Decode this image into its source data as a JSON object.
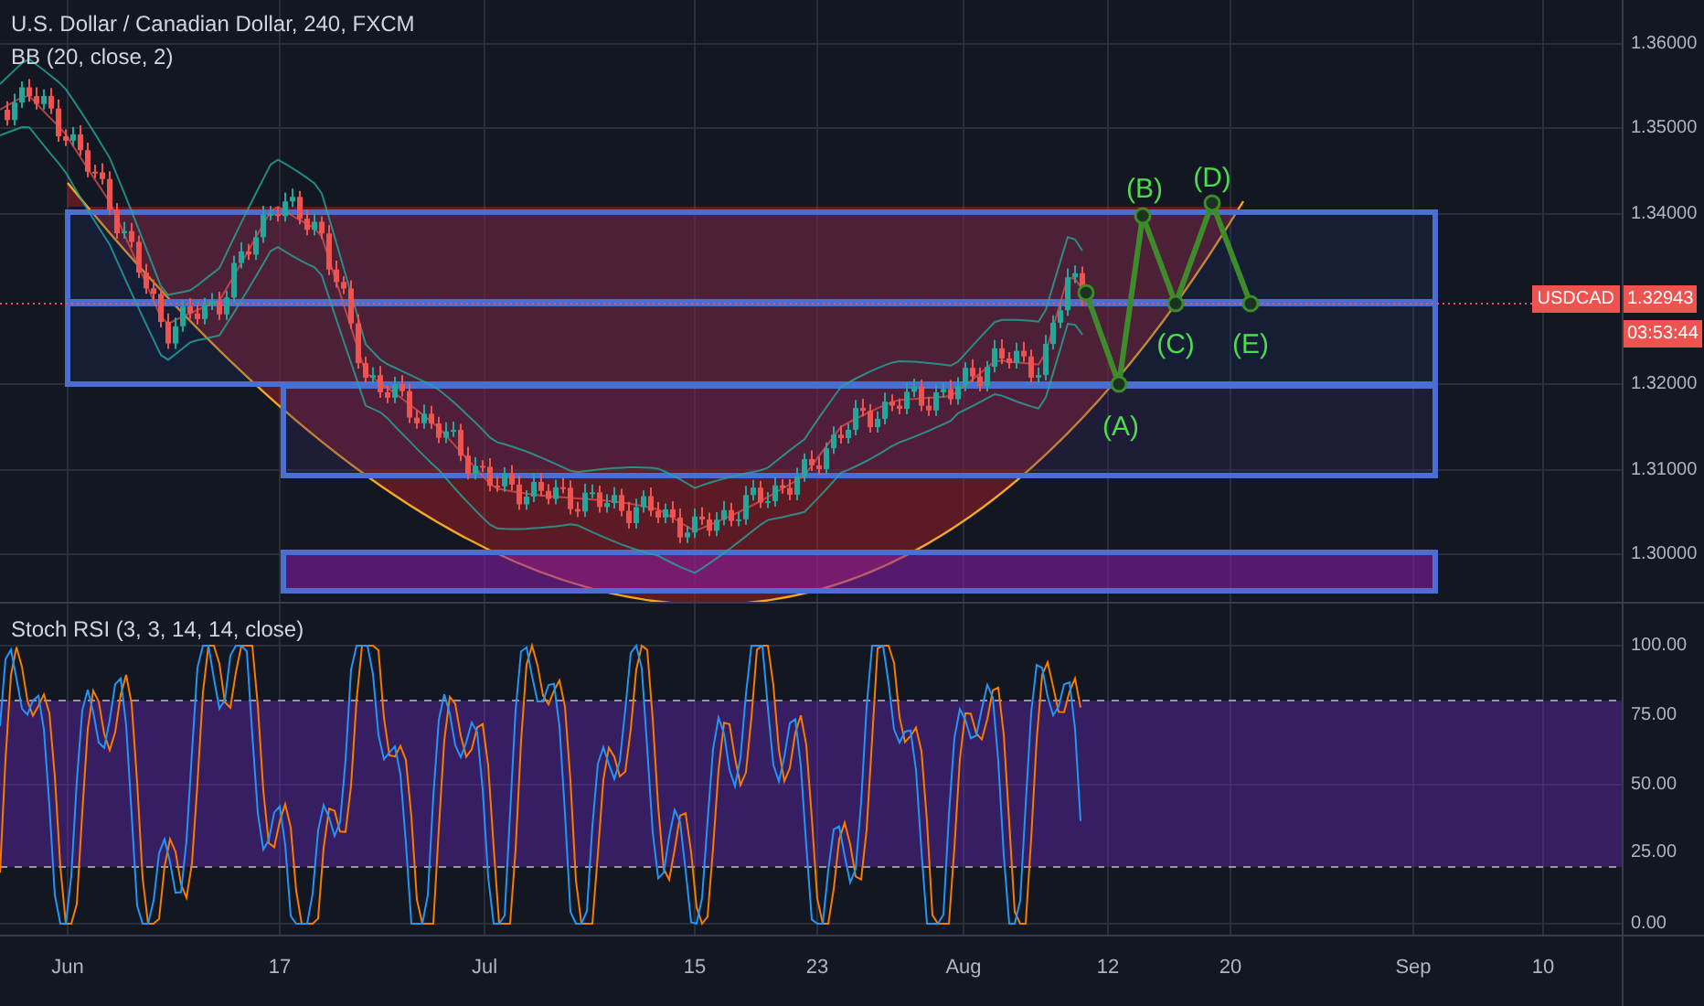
{
  "chart": {
    "title": "U.S. Dollar / Canadian Dollar, 240, FXCM",
    "indicator": "BB (20, close, 2)",
    "price_axis": [
      "1.36000",
      "1.35000",
      "1.34000",
      "1.32000",
      "1.31000",
      "1.30000"
    ],
    "symbol_label": "USDCAD",
    "last_price": "1.32943",
    "countdown": "03:53:44",
    "pattern_labels": [
      "(A)",
      "(B)",
      "(C)",
      "(D)",
      "(E)"
    ]
  },
  "oscillator": {
    "title": "Stoch RSI (3, 3, 14, 14, close)",
    "axis": [
      "100.00",
      "75.00",
      "50.00",
      "25.00",
      "0.00"
    ]
  },
  "time_axis": [
    "Jun",
    "17",
    "Jul",
    "15",
    "23",
    "Aug",
    "12",
    "20",
    "Sep",
    "10"
  ]
}
